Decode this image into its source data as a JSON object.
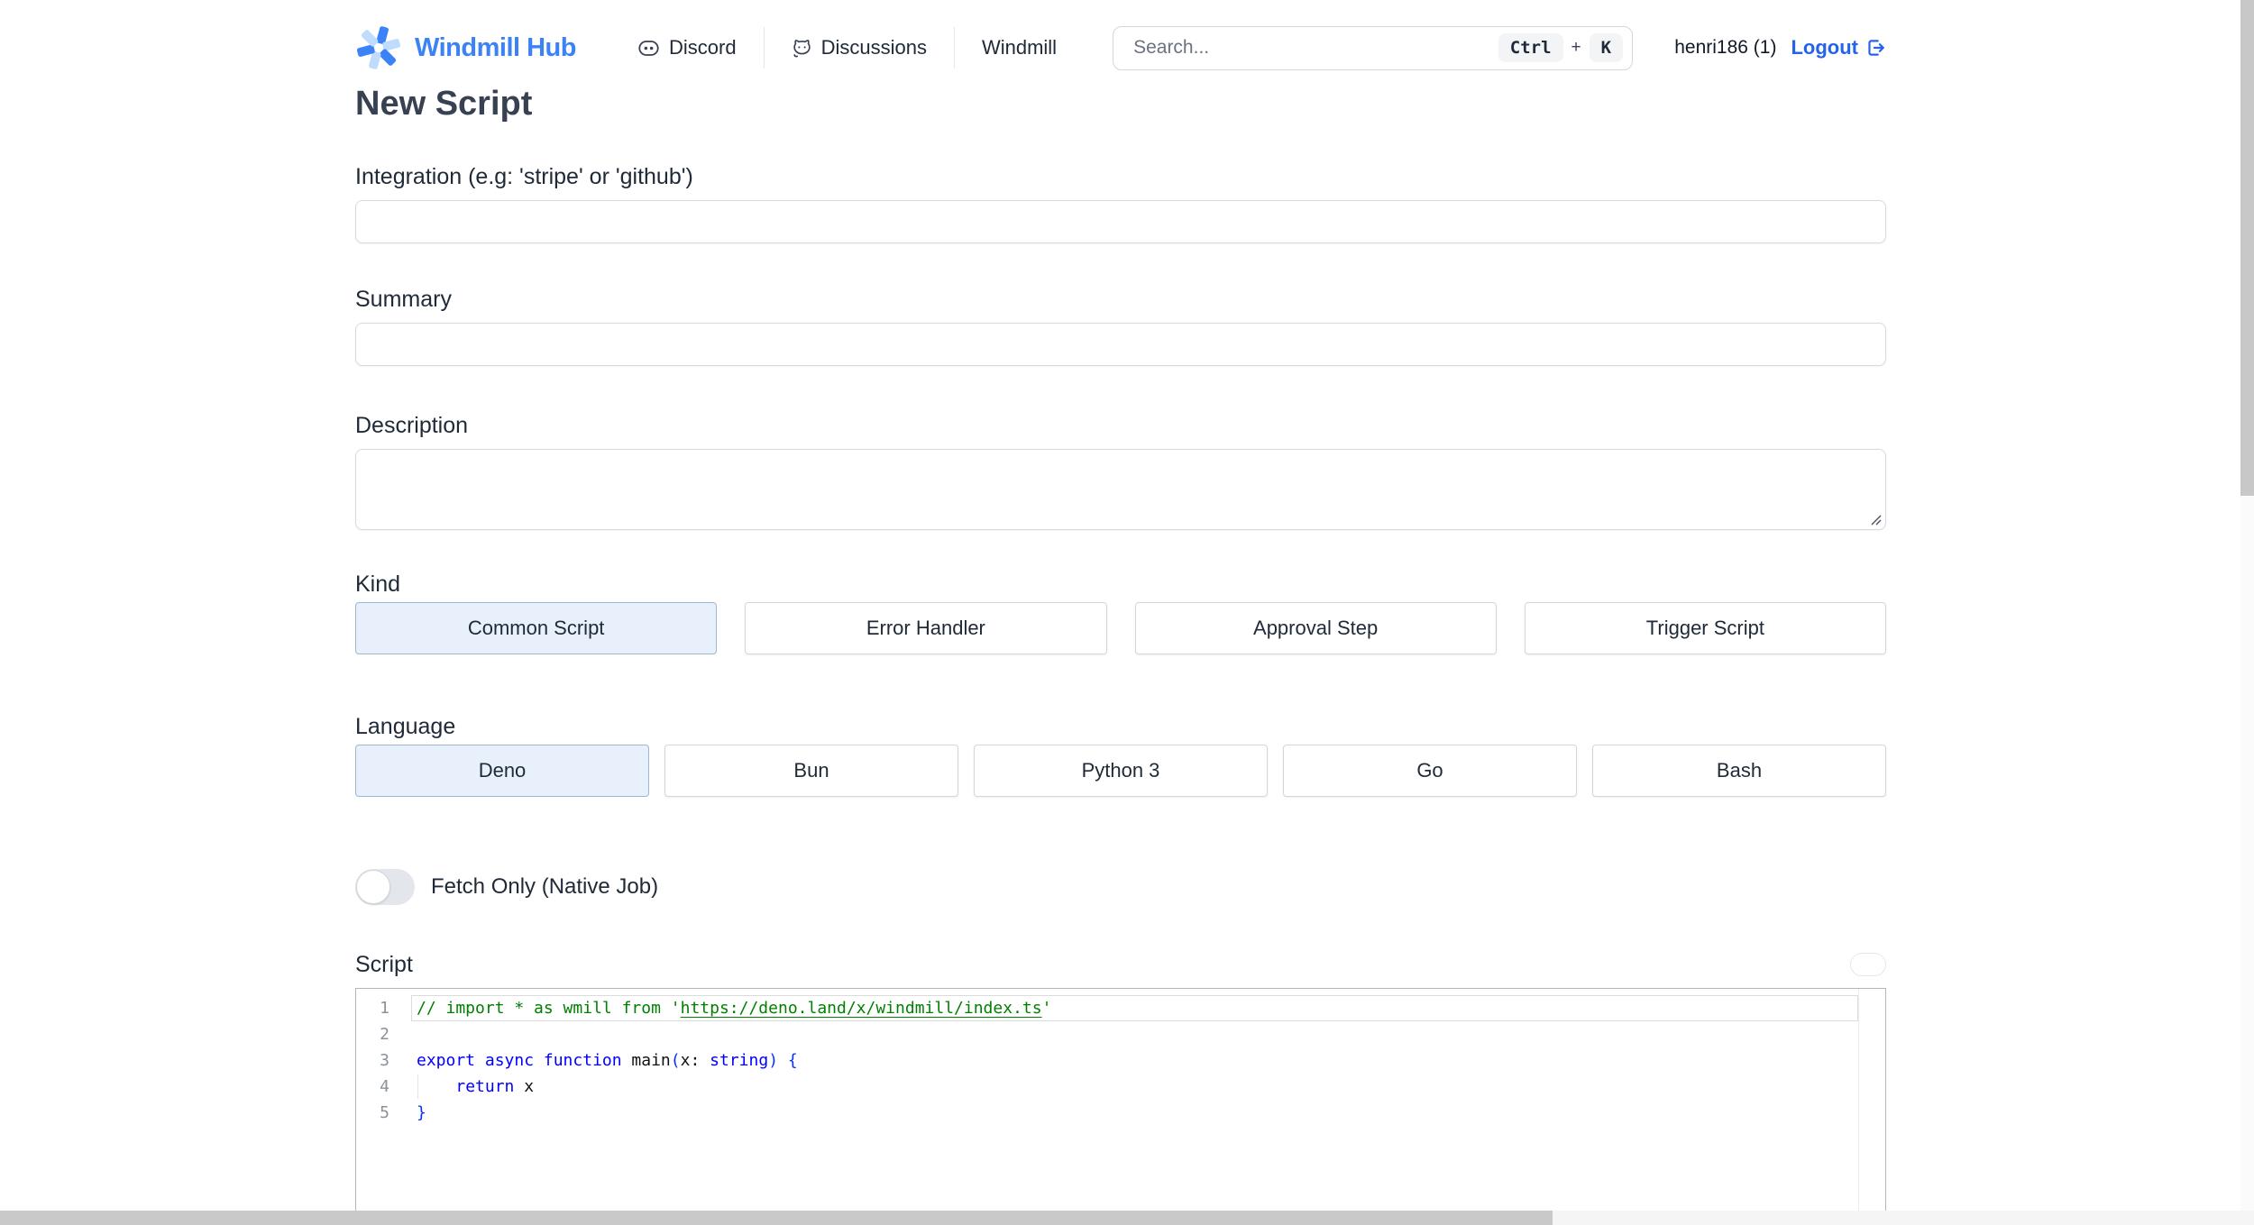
{
  "colors": {
    "accent_blue": "#3b82f6",
    "logout_blue": "#2563eb",
    "selected_bg": "#e8f1fb",
    "selected_border": "#9fb6cf",
    "border_gray": "#d6dade",
    "text_dark": "#1f2937",
    "comment_green": "#008000",
    "keyword_blue": "#0000ff"
  },
  "header": {
    "logo": {
      "text": "Windmill Hub"
    },
    "nav": {
      "discord": "Discord",
      "discussions": "Discussions",
      "windmill": "Windmill"
    },
    "search": {
      "placeholder": "Search...",
      "key1": "Ctrl",
      "separator": "+",
      "key2": "K"
    },
    "user": {
      "name": "henri186 (1)",
      "logout": "Logout"
    }
  },
  "page": {
    "title": "New Script"
  },
  "form": {
    "integration": {
      "label": "Integration (e.g: 'stripe' or 'github')",
      "value": ""
    },
    "summary": {
      "label": "Summary",
      "value": ""
    },
    "description": {
      "label": "Description",
      "value": ""
    },
    "kind": {
      "label": "Kind",
      "options": [
        "Common Script",
        "Error Handler",
        "Approval Step",
        "Trigger Script"
      ],
      "selected": "Common Script"
    },
    "language": {
      "label": "Language",
      "options": [
        "Deno",
        "Bun",
        "Python 3",
        "Go",
        "Bash"
      ],
      "selected": "Deno"
    },
    "fetch_only": {
      "label": "Fetch Only (Native Job)",
      "enabled": false
    },
    "script": {
      "label": "Script"
    }
  },
  "editor": {
    "current_line": 1,
    "lines": [
      {
        "number": 1,
        "tokens": [
          {
            "t": "// import * as wmill from '",
            "c": "comment"
          },
          {
            "t": "https://deno.land/x/windmill/index.ts",
            "c": "comment link"
          },
          {
            "t": "'",
            "c": "comment"
          }
        ]
      },
      {
        "number": 2,
        "tokens": []
      },
      {
        "number": 3,
        "tokens": [
          {
            "t": "export async function ",
            "c": "kw"
          },
          {
            "t": "main",
            "c": "plain"
          },
          {
            "t": "(",
            "c": "bracket"
          },
          {
            "t": "x",
            "c": "plain"
          },
          {
            "t": ": ",
            "c": "plain"
          },
          {
            "t": "string",
            "c": "kw"
          },
          {
            "t": ") ",
            "c": "bracket"
          },
          {
            "t": "{",
            "c": "bracket"
          }
        ]
      },
      {
        "number": 4,
        "indent_guide": true,
        "tokens": [
          {
            "t": "    ",
            "c": "plain"
          },
          {
            "t": "return",
            "c": "kw"
          },
          {
            "t": " x",
            "c": "plain"
          }
        ]
      },
      {
        "number": 5,
        "tokens": [
          {
            "t": "}",
            "c": "bracket"
          }
        ]
      }
    ]
  }
}
